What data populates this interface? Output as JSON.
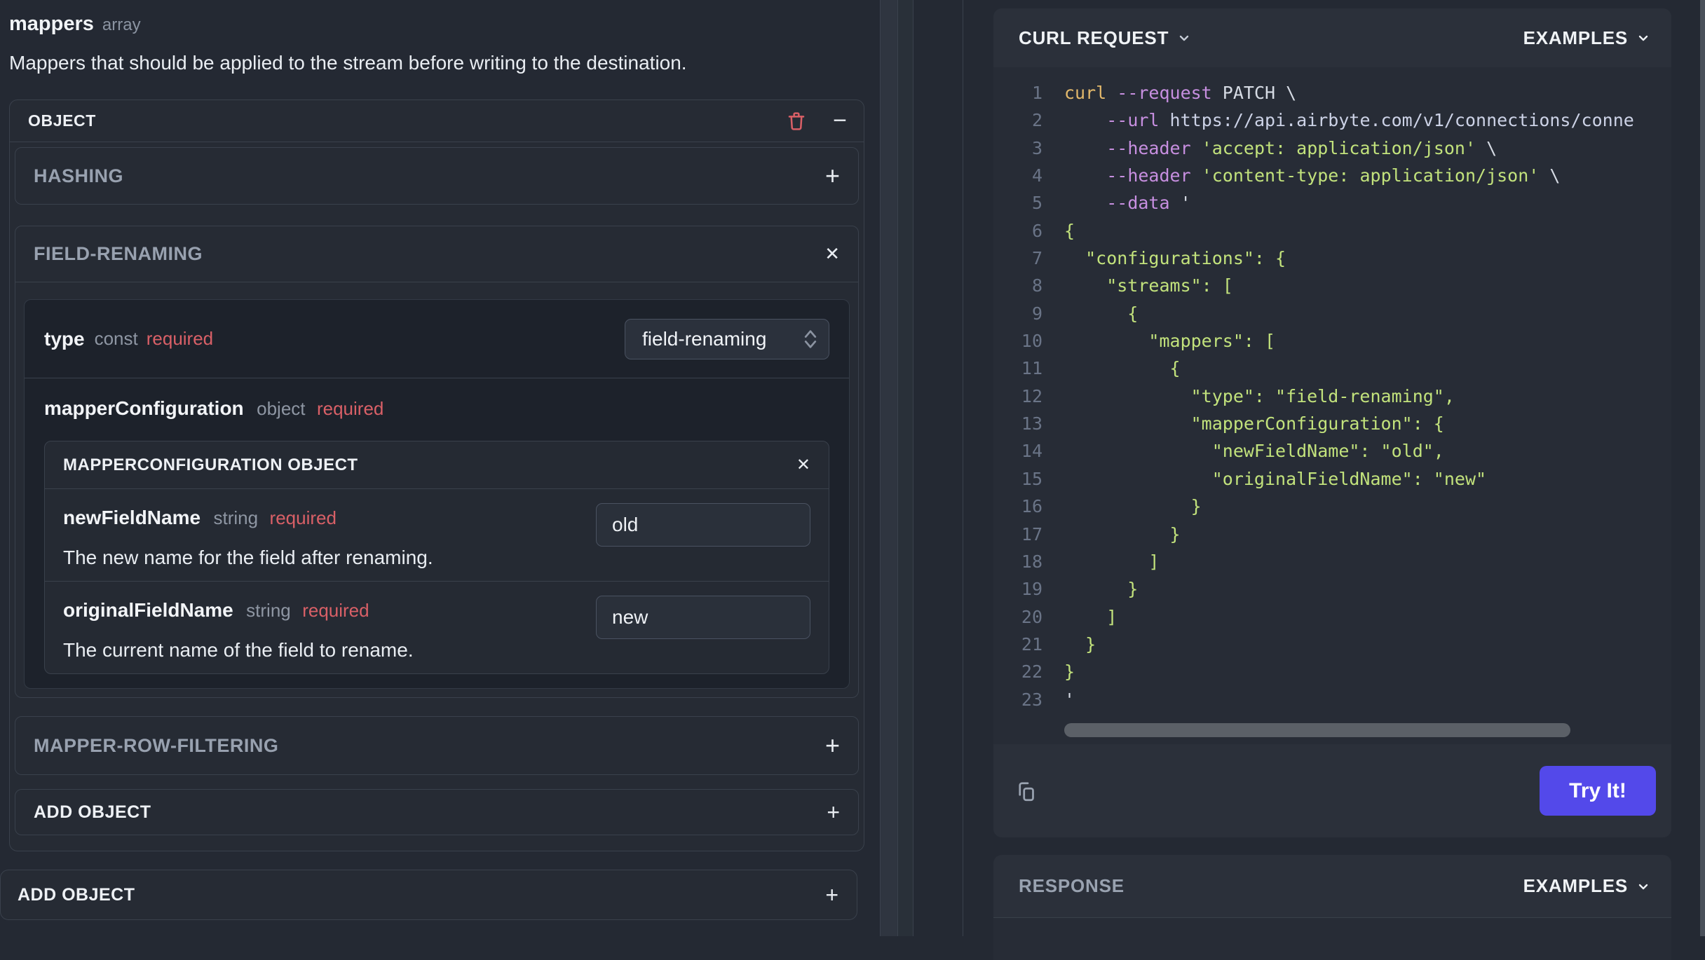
{
  "page": {
    "field_name": "mappers",
    "field_kind": "array",
    "field_description": "Mappers that should be applied to the stream before writing to the destination."
  },
  "object_card": {
    "title": "OBJECT",
    "hashing": {
      "title": "HASHING",
      "action": "+"
    },
    "field_renaming": {
      "title": "FIELD-RENAMING",
      "close": "✕",
      "type_row": {
        "name": "type",
        "kind": "const",
        "required": "required",
        "value": "field-renaming"
      },
      "mapper_configuration": {
        "name": "mapperConfiguration",
        "kind": "object",
        "required": "required",
        "card_title": "MAPPERCONFIGURATION OBJECT",
        "close": "✕",
        "fields": [
          {
            "name": "newFieldName",
            "kind": "string",
            "required": "required",
            "value": "old",
            "description": "The new name for the field after renaming."
          },
          {
            "name": "originalFieldName",
            "kind": "string",
            "required": "required",
            "value": "new",
            "description": "The current name of the field to rename."
          }
        ]
      }
    },
    "mapper_row_filtering": {
      "title": "MAPPER-ROW-FILTERING",
      "action": "+"
    },
    "add_object": {
      "label": "ADD OBJECT",
      "action": "+"
    },
    "remove_glyph": "−"
  },
  "outer_add_object": {
    "label": "ADD OBJECT",
    "action": "+"
  },
  "request_panel": {
    "title": "CURL REQUEST",
    "examples_label": "EXAMPLES",
    "try_button": "Try It!",
    "code": {
      "lines": [
        {
          "n": "1",
          "s": [
            {
              "c": "c",
              "t": "curl "
            },
            {
              "c": "f",
              "t": "--request"
            },
            {
              "c": "p",
              "t": " PATCH \\"
            }
          ]
        },
        {
          "n": "2",
          "s": [
            {
              "c": "p",
              "t": "    "
            },
            {
              "c": "f",
              "t": "--url"
            },
            {
              "c": "u",
              "t": " https://api.airbyte.com/v1/connections/conne"
            }
          ]
        },
        {
          "n": "3",
          "s": [
            {
              "c": "p",
              "t": "    "
            },
            {
              "c": "f",
              "t": "--header"
            },
            {
              "c": "s",
              "t": " 'accept: application/json'"
            },
            {
              "c": "p",
              "t": " \\"
            }
          ]
        },
        {
          "n": "4",
          "s": [
            {
              "c": "p",
              "t": "    "
            },
            {
              "c": "f",
              "t": "--header"
            },
            {
              "c": "s",
              "t": " 'content-type: application/json'"
            },
            {
              "c": "p",
              "t": " \\"
            }
          ]
        },
        {
          "n": "5",
          "s": [
            {
              "c": "p",
              "t": "    "
            },
            {
              "c": "f",
              "t": "--data"
            },
            {
              "c": "p",
              "t": " '"
            }
          ]
        },
        {
          "n": "6",
          "s": [
            {
              "c": "s",
              "t": "{"
            }
          ]
        },
        {
          "n": "7",
          "s": [
            {
              "c": "s",
              "t": "  \"configurations\": {"
            }
          ]
        },
        {
          "n": "8",
          "s": [
            {
              "c": "s",
              "t": "    \"streams\": ["
            }
          ]
        },
        {
          "n": "9",
          "s": [
            {
              "c": "s",
              "t": "      {"
            }
          ]
        },
        {
          "n": "10",
          "s": [
            {
              "c": "s",
              "t": "        \"mappers\": ["
            }
          ]
        },
        {
          "n": "11",
          "s": [
            {
              "c": "s",
              "t": "          {"
            }
          ]
        },
        {
          "n": "12",
          "s": [
            {
              "c": "s",
              "t": "            \"type\": \"field-renaming\","
            }
          ]
        },
        {
          "n": "13",
          "s": [
            {
              "c": "s",
              "t": "            \"mapperConfiguration\": {"
            }
          ]
        },
        {
          "n": "14",
          "s": [
            {
              "c": "s",
              "t": "              \"newFieldName\": \"old\","
            }
          ]
        },
        {
          "n": "15",
          "s": [
            {
              "c": "s",
              "t": "              \"originalFieldName\": \"new\""
            }
          ]
        },
        {
          "n": "16",
          "s": [
            {
              "c": "s",
              "t": "            }"
            }
          ]
        },
        {
          "n": "17",
          "s": [
            {
              "c": "s",
              "t": "          }"
            }
          ]
        },
        {
          "n": "18",
          "s": [
            {
              "c": "s",
              "t": "        ]"
            }
          ]
        },
        {
          "n": "19",
          "s": [
            {
              "c": "s",
              "t": "      }"
            }
          ]
        },
        {
          "n": "20",
          "s": [
            {
              "c": "s",
              "t": "    ]"
            }
          ]
        },
        {
          "n": "21",
          "s": [
            {
              "c": "s",
              "t": "  }"
            }
          ]
        },
        {
          "n": "22",
          "s": [
            {
              "c": "s",
              "t": "}"
            }
          ]
        },
        {
          "n": "23",
          "s": [
            {
              "c": "p",
              "t": "'"
            }
          ]
        }
      ]
    }
  },
  "response_panel": {
    "title": "RESPONSE",
    "examples_label": "EXAMPLES"
  },
  "accents": {
    "try_button_bg": "#5349ea",
    "required_red": "#d96067",
    "trash_red": "#d95f66",
    "code_command": "#e2b86b",
    "code_flag": "#c78fe0",
    "code_string": "#c2e27c",
    "code_url": "#ccd2e6",
    "line_number": "#6a7487"
  }
}
